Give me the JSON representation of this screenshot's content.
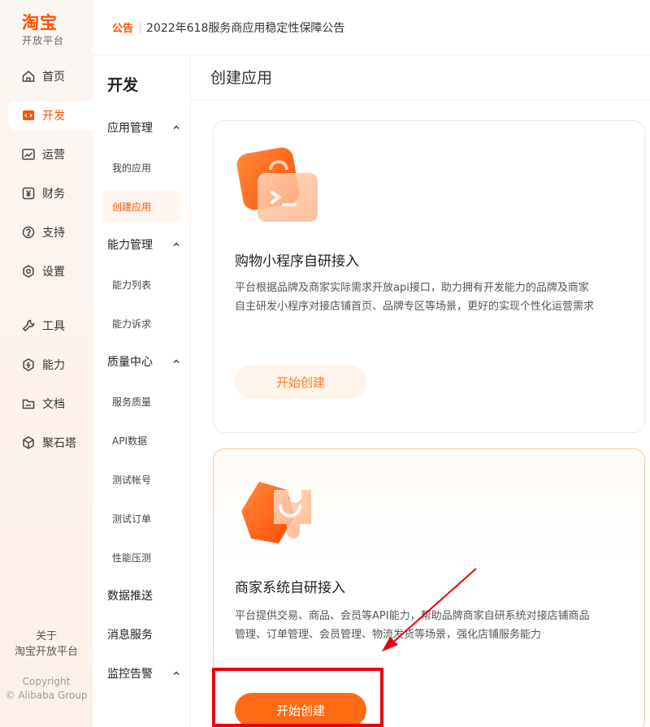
{
  "rail": {
    "brand": "淘宝",
    "subtitle": "开放平台",
    "items": [
      {
        "label": "首页",
        "icon": "home-icon"
      },
      {
        "label": "开发",
        "icon": "code-icon"
      },
      {
        "label": "运营",
        "icon": "chart-icon"
      },
      {
        "label": "财务",
        "icon": "yuan-icon"
      },
      {
        "label": "支持",
        "icon": "help-icon"
      },
      {
        "label": "设置",
        "icon": "gear-icon"
      },
      {
        "label": "工具",
        "icon": "wrench-icon"
      },
      {
        "label": "能力",
        "icon": "capability-icon"
      },
      {
        "label": "文档",
        "icon": "folder-icon"
      },
      {
        "label": "聚石塔",
        "icon": "cube-icon"
      }
    ],
    "active_item": "开发",
    "about_line1": "关于",
    "about_line2": "淘宝开放平台",
    "copyright_line1": "Copyright",
    "copyright_line2": "© Alibaba Group"
  },
  "topbar": {
    "tag": "公告",
    "notice": "2022年618服务商应用稳定性保障公告"
  },
  "submenu": {
    "title": "开发",
    "groups": [
      {
        "label": "应用管理",
        "expanded": true,
        "items": [
          "我的应用",
          "创建应用"
        ]
      },
      {
        "label": "能力管理",
        "expanded": true,
        "items": [
          "能力列表",
          "能力诉求"
        ]
      },
      {
        "label": "质量中心",
        "expanded": true,
        "items": [
          "服务质量",
          "API数据",
          "测试帐号",
          "测试订单",
          "性能压测"
        ]
      },
      {
        "label": "数据推送"
      },
      {
        "label": "消息服务"
      },
      {
        "label": "监控告警",
        "expanded": true
      }
    ],
    "active_item": "创建应用"
  },
  "main": {
    "title": "创建应用",
    "cards": [
      {
        "title": "购物小程序自研接入",
        "desc_line1": "平台根据品牌及商家实际需求开放api接口，助力拥有开发能力的品牌及商家",
        "desc_line2": "自主研发小程序对接店铺首页、品牌专区等场景，更好的实现个性化运营需求",
        "button": "开始创建"
      },
      {
        "title": "商家系统自研接入",
        "desc_line1": "平台提供交易、商品、会员等API能力，帮助品牌商家自研系统对接店铺商品",
        "desc_line2": "管理、订单管理、会员管理、物流发货等场景，强化店铺服务能力",
        "button": "开始创建"
      }
    ]
  },
  "colors": {
    "brand": "#ff5000",
    "button": "#ff6a14",
    "annotation": "#e8000e"
  }
}
